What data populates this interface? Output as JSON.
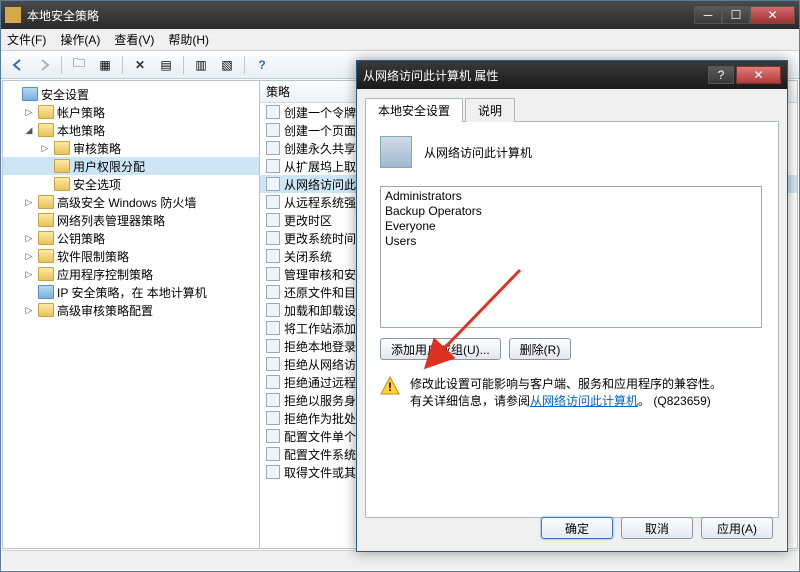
{
  "window": {
    "title": "本地安全策略",
    "menu": {
      "file": "文件(F)",
      "action": "操作(A)",
      "view": "查看(V)",
      "help": "帮助(H)"
    }
  },
  "tree": {
    "root": "安全设置",
    "items": [
      {
        "label": "帐户策略",
        "toggle": "▷",
        "indent": 1
      },
      {
        "label": "本地策略",
        "toggle": "◢",
        "indent": 1
      },
      {
        "label": "审核策略",
        "toggle": "▷",
        "indent": 2
      },
      {
        "label": "用户权限分配",
        "toggle": "",
        "indent": 2,
        "selected": true
      },
      {
        "label": "安全选项",
        "toggle": "",
        "indent": 2
      },
      {
        "label": "高级安全 Windows 防火墙",
        "toggle": "▷",
        "indent": 1
      },
      {
        "label": "网络列表管理器策略",
        "toggle": "",
        "indent": 1
      },
      {
        "label": "公钥策略",
        "toggle": "▷",
        "indent": 1
      },
      {
        "label": "软件限制策略",
        "toggle": "▷",
        "indent": 1
      },
      {
        "label": "应用程序控制策略",
        "toggle": "▷",
        "indent": 1
      },
      {
        "label": "IP 安全策略，在 本地计算机",
        "toggle": "",
        "indent": 1,
        "blue": true
      },
      {
        "label": "高级审核策略配置",
        "toggle": "▷",
        "indent": 1
      }
    ]
  },
  "list": {
    "header": "策略",
    "items": [
      "创建一个令牌",
      "创建一个页面",
      "创建永久共享",
      "从扩展坞上取",
      {
        "label": "从网络访问此",
        "selected": true
      },
      "从远程系统强",
      "更改时区",
      "更改系统时间",
      "关闭系统",
      "管理审核和安",
      "还原文件和目",
      "加载和卸载设",
      "将工作站添加",
      "拒绝本地登录",
      "拒绝从网络访",
      "拒绝通过远程",
      "拒绝以服务身",
      "拒绝作为批处",
      "配置文件单个",
      "配置文件系统",
      "取得文件或其"
    ]
  },
  "dialog": {
    "title": "从网络访问此计算机 属性",
    "tabs": {
      "local": "本地安全设置",
      "explain": "说明"
    },
    "policy_name": "从网络访问此计算机",
    "users": [
      "Administrators",
      "Backup Operators",
      "Everyone",
      "Users"
    ],
    "add_btn": "添加用户或组(U)...",
    "remove_btn": "删除(R)",
    "warning_line1": "修改此设置可能影响与客户端、服务和应用程序的兼容性。",
    "warning_line2a": "有关详细信息，请参阅",
    "warning_link": "从网络访问此计算机",
    "warning_line2b": "。 (Q823659)",
    "ok": "确定",
    "cancel": "取消",
    "apply": "应用(A)"
  }
}
